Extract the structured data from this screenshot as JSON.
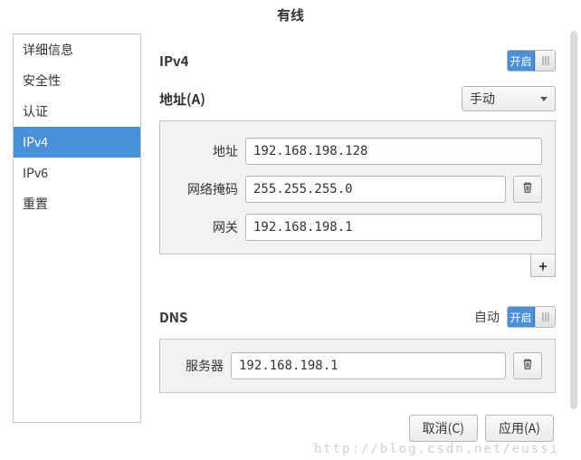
{
  "title": "有线",
  "sidebar": {
    "items": [
      {
        "label": "详细信息"
      },
      {
        "label": "安全性"
      },
      {
        "label": "认证"
      },
      {
        "label": "IPv4"
      },
      {
        "label": "IPv6"
      },
      {
        "label": "重置"
      }
    ],
    "selected_index": 3
  },
  "ipv4": {
    "section_label": "IPv4",
    "toggle_on_label": "开启",
    "addresses_label": "地址(A)",
    "mode_selected": "手动",
    "fields": {
      "address_label": "地址",
      "address_value": "192.168.198.128",
      "netmask_label": "网络掩码",
      "netmask_value": "255.255.255.0",
      "gateway_label": "网关",
      "gateway_value": "192.168.198.1"
    },
    "add_button_label": "+"
  },
  "dns": {
    "section_label": "DNS",
    "auto_label": "自动",
    "toggle_on_label": "开启",
    "server_label": "服务器",
    "server_value": "192.168.198.1"
  },
  "buttons": {
    "cancel": "取消(C)",
    "apply": "应用(A)"
  },
  "watermark": "http://blog.csdn.net/eussi"
}
